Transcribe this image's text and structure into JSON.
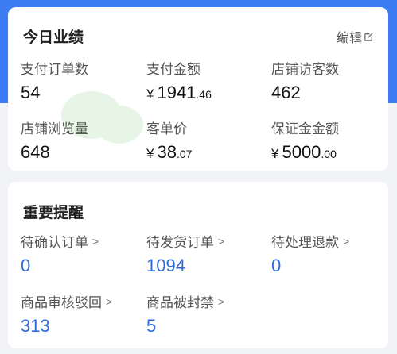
{
  "colors": {
    "accent": "#3d7df4",
    "value_blue": "#2f6ad9"
  },
  "today": {
    "title": "今日业绩",
    "edit_label": "编辑",
    "edit_icon": "edit-icon",
    "stats": [
      {
        "label": "支付订单数",
        "value": "54"
      },
      {
        "label": "支付金额",
        "currency": "¥",
        "integer": "1941",
        "decimal": ".46"
      },
      {
        "label": "店铺访客数",
        "value": "462"
      },
      {
        "label": "店铺浏览量",
        "value": "648"
      },
      {
        "label": "客单价",
        "currency": "¥",
        "integer": "38",
        "decimal": ".07"
      },
      {
        "label": "保证金金额",
        "currency": "¥",
        "integer": "5000",
        "decimal": ".00"
      }
    ]
  },
  "reminders": {
    "title": "重要提醒",
    "items": [
      {
        "label": "待确认订单",
        "value": "0"
      },
      {
        "label": "待发货订单",
        "value": "1094"
      },
      {
        "label": "待处理退款",
        "value": "0"
      },
      {
        "label": "商品审核驳回",
        "value": "313"
      },
      {
        "label": "商品被封禁",
        "value": "5"
      }
    ],
    "chevron": ">"
  }
}
